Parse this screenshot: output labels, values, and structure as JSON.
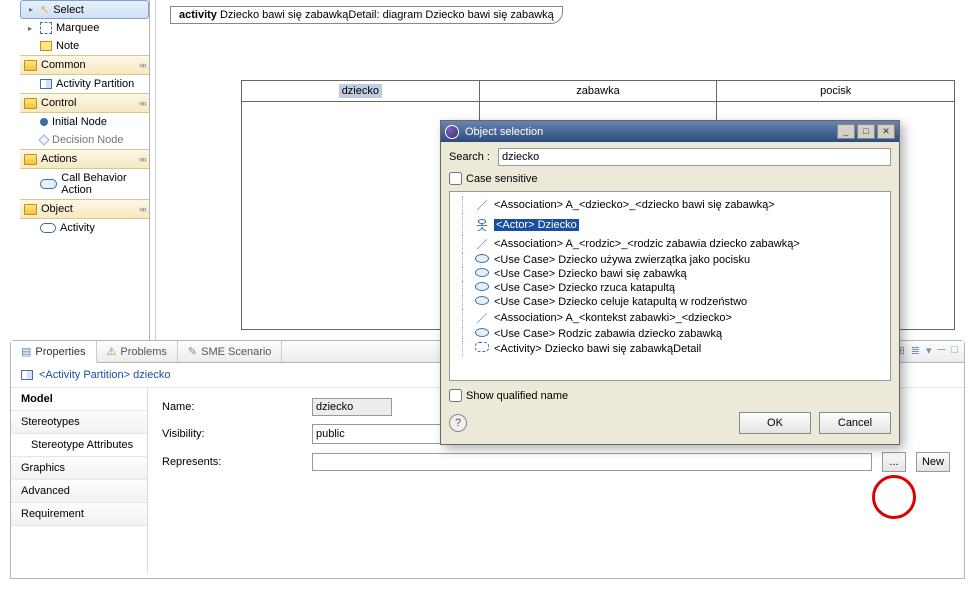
{
  "palette": {
    "tools": {
      "select": "Select",
      "marquee": "Marquee",
      "note": "Note"
    },
    "groups": {
      "common": {
        "label": "Common",
        "items": [
          "Activity Partition"
        ]
      },
      "control": {
        "label": "Control",
        "items": [
          "Initial Node",
          "Decision Node"
        ]
      },
      "actions": {
        "label": "Actions",
        "items": [
          "Call Behavior Action"
        ]
      },
      "object": {
        "label": "Object",
        "items": [
          "Activity"
        ]
      }
    }
  },
  "canvas": {
    "header_bold": "activity",
    "header_rest": "Dziecko bawi się zabawkąDetail: diagram Dziecko bawi się zabawką",
    "lanes": [
      "dziecko",
      "zabawka",
      "pocisk"
    ]
  },
  "bottom": {
    "tabs": [
      "Properties",
      "Problems",
      "SME Scenario"
    ],
    "title_prefix": "<Activity Partition>",
    "title_name": "dziecko",
    "side": [
      "Model",
      "Stereotypes",
      "Stereotype Attributes",
      "Graphics",
      "Advanced",
      "Requirement"
    ],
    "form": {
      "name_label": "Name:",
      "name_value": "dziecko",
      "visibility_label": "Visibility:",
      "visibility_value": "public",
      "represents_label": "Represents:",
      "represents_value": "",
      "new_btn": "New"
    }
  },
  "dialog": {
    "title": "Object selection",
    "search_label": "Search :",
    "search_value": "dziecko",
    "case_label": "Case sensitive",
    "show_qualified_label": "Show qualified name",
    "ok": "OK",
    "cancel": "Cancel",
    "items": [
      {
        "icon": "assoc",
        "label": "<Association> A_<dziecko>_<dziecko bawi się zabawką>"
      },
      {
        "icon": "actor",
        "label": "<Actor> Dziecko",
        "selected": true
      },
      {
        "icon": "assoc",
        "label": "<Association> A_<rodzic>_<rodzic zabawia dziecko zabawką>"
      },
      {
        "icon": "usecase",
        "label": "<Use Case> Dziecko używa zwierzątka jako pocisku"
      },
      {
        "icon": "usecase",
        "label": "<Use Case> Dziecko bawi się zabawką"
      },
      {
        "icon": "usecase",
        "label": "<Use Case> Dziecko rzuca katapultą"
      },
      {
        "icon": "usecase",
        "label": "<Use Case> Dziecko celuje katapultą w rodzeństwo"
      },
      {
        "icon": "assoc",
        "label": "<Association> A_<kontekst zabawki>_<dziecko>"
      },
      {
        "icon": "usecase",
        "label": "<Use Case> Rodzic zabawia dziecko zabawką"
      },
      {
        "icon": "activity",
        "label": "<Activity> Dziecko bawi się zabawkąDetail"
      }
    ]
  }
}
